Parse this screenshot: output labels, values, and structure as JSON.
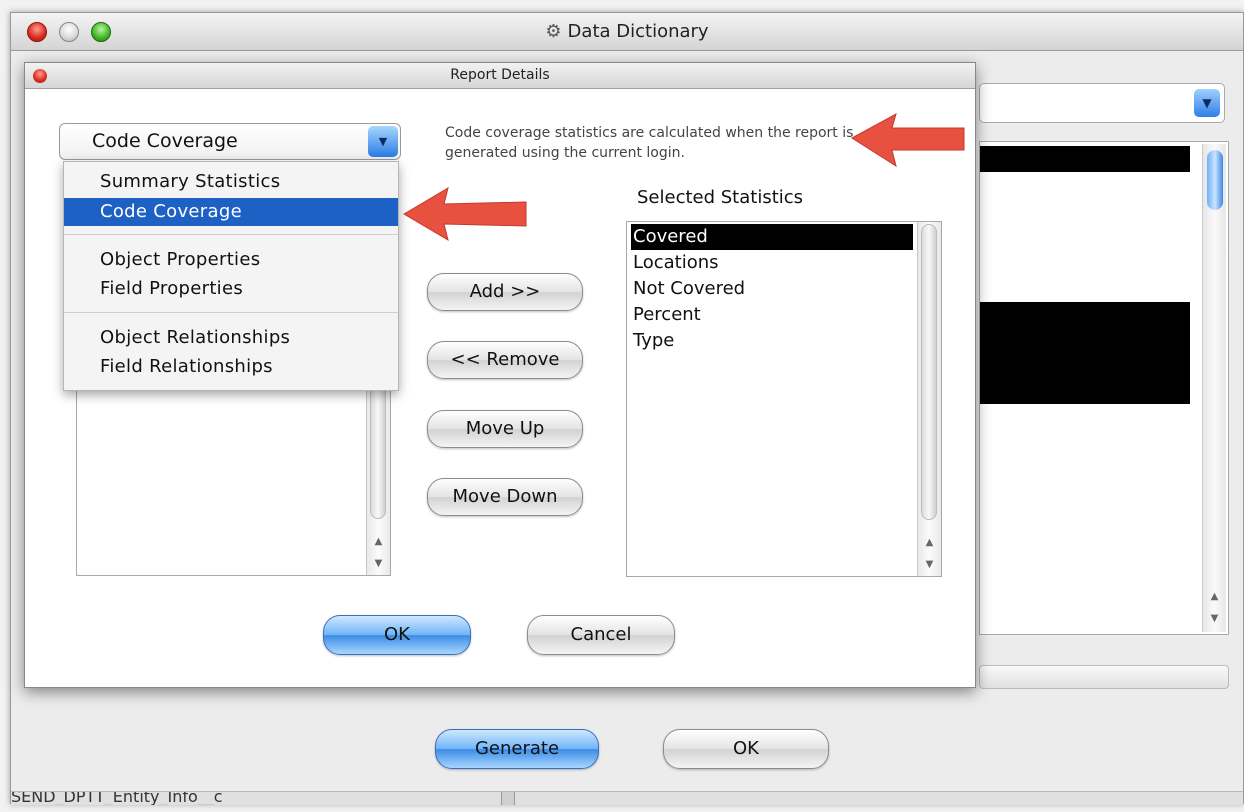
{
  "main_window": {
    "title": "Data Dictionary",
    "title_icon": "gear-icon",
    "generate_label": "Generate",
    "ok_label": "OK",
    "bottom_text": "SEND_DPTT_Entity_Info__c"
  },
  "dialog": {
    "title": "Report Details",
    "combo": {
      "selected": "Code Coverage",
      "icon": "chevron-down-icon"
    },
    "menu": {
      "items": [
        "Summary Statistics",
        "Code Coverage",
        "Object Properties",
        "Field Properties",
        "Object Relationships",
        "Field Relationships"
      ],
      "selected_index": 1
    },
    "hint_text": "Code coverage statistics are calculated when the report is generated using the current login.",
    "selected_heading": "Selected Statistics",
    "selected_items": [
      "Covered",
      "Locations",
      "Not Covered",
      "Percent",
      "Type"
    ],
    "selected_item_index": 0,
    "buttons": {
      "add": "Add >>",
      "remove": "<< Remove",
      "move_up": "Move Up",
      "move_down": "Move Down",
      "ok": "OK",
      "cancel": "Cancel"
    }
  },
  "colors": {
    "selection_blue": "#1d61c4",
    "annotation_arrow": "#e8503f",
    "list_selection": "#000000"
  }
}
